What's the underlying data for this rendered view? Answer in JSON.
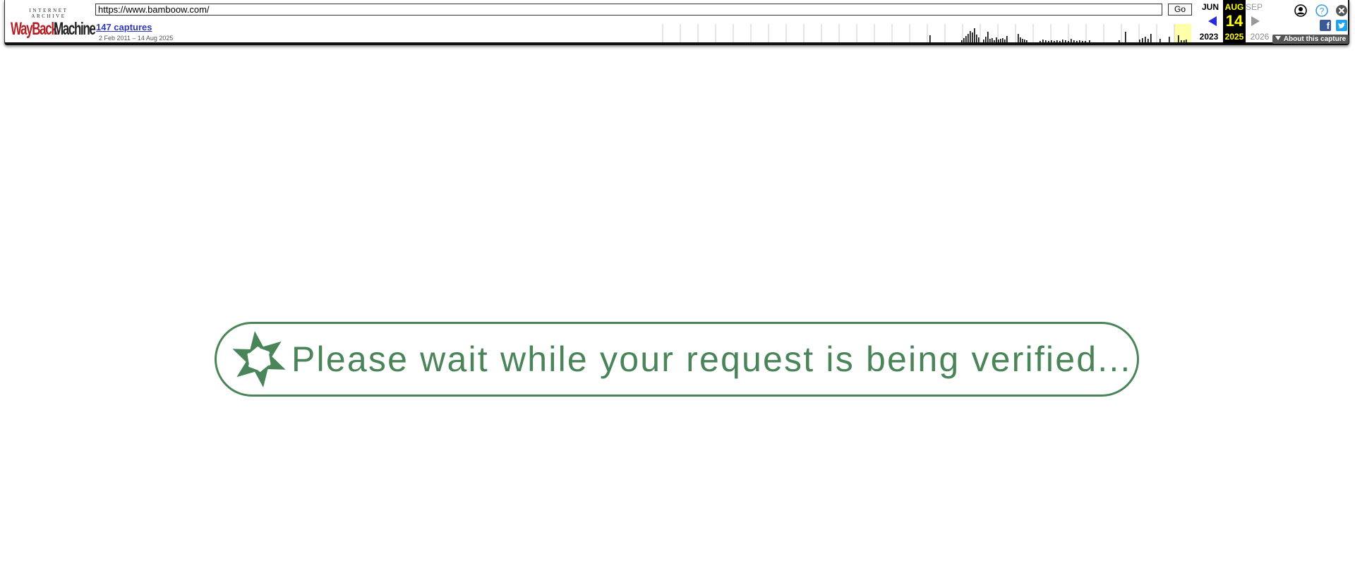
{
  "toolbar": {
    "logo": {
      "top_text": "INTERNET ARCHIVE",
      "word1": "WayBack",
      "word2": "Machine"
    },
    "url": "https://www.bamboow.com/",
    "go_label": "Go",
    "captures_label": "147 captures",
    "captures_range": "2 Feb 2011 – 14 Aug 2025",
    "calendar": {
      "prev_month": "JUN",
      "current_month": "AUG",
      "next_month": "SEP",
      "current_day": "14",
      "prev_year": "2023",
      "current_year": "2025",
      "next_year": "2026"
    },
    "about_label": "About this capture",
    "facebook_glyph": "f",
    "icons": {
      "user": "user-icon",
      "help": "help-icon",
      "close": "close-icon",
      "facebook": "facebook-icon",
      "twitter": "twitter-icon",
      "prev": "arrow-left-icon",
      "next": "arrow-right-icon"
    },
    "colors": {
      "link": "#2e37bf",
      "current_highlight": "#ffff00",
      "prev_arrow": "#2929dd",
      "sparkline_highlight": "#ffffaa"
    }
  },
  "main": {
    "message": "Please wait while your request is being verified...",
    "accent_color": "#4a8459"
  }
}
